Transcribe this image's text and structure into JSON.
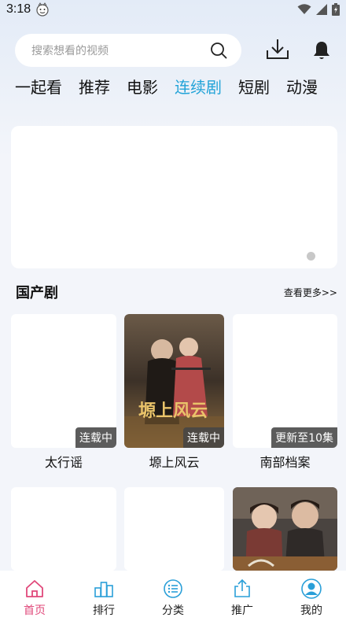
{
  "status": {
    "time": "3:18"
  },
  "search": {
    "placeholder": "搜索想看的视频"
  },
  "tabs": [
    {
      "label": "一起看"
    },
    {
      "label": "推荐"
    },
    {
      "label": "电影"
    },
    {
      "label": "连续剧",
      "active": true
    },
    {
      "label": "短剧"
    },
    {
      "label": "动漫"
    }
  ],
  "section": {
    "title": "国产剧",
    "more": "查看更多>>"
  },
  "cards": [
    {
      "title": "太行谣",
      "badge": "连载中"
    },
    {
      "title": "塬上风云",
      "badge": "连载中",
      "poster_text": "塬上风云"
    },
    {
      "title": "南部档案",
      "badge": "更新至10集"
    },
    {
      "title": "",
      "badge": ""
    },
    {
      "title": "",
      "badge": ""
    },
    {
      "title": "",
      "badge": ""
    }
  ],
  "nav": [
    {
      "label": "首页",
      "icon": "home-icon",
      "active": true
    },
    {
      "label": "排行",
      "icon": "ranking-icon"
    },
    {
      "label": "分类",
      "icon": "category-icon"
    },
    {
      "label": "推广",
      "icon": "share-icon"
    },
    {
      "label": "我的",
      "icon": "profile-icon"
    }
  ],
  "colors": {
    "accent": "#22a3d8",
    "nav_active": "#e0487a",
    "nav_icon": "#2a9fd8"
  }
}
